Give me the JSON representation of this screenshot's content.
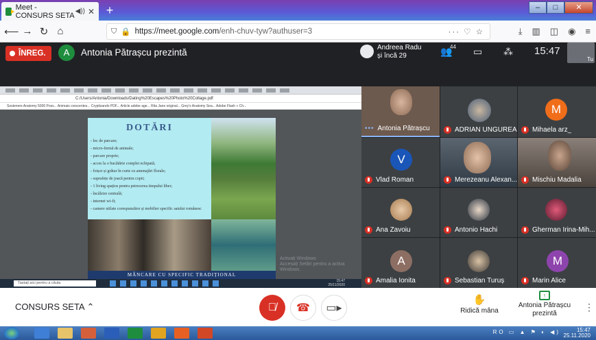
{
  "browser": {
    "tab_title": "Meet - CONSURS SETA",
    "new_tab": "+",
    "url_host": "https://meet.google.com",
    "url_path": "/enh-chuv-tyw?authuser=3",
    "url_extra": "··· ♡ ☆",
    "controls": {
      "minimize": "–",
      "maximize": "□",
      "close": "✕"
    }
  },
  "meet": {
    "recording_label": "ÎNREG.",
    "presenter_initial": "A",
    "presenter_text": "Antonia Pătrașcu prezintă",
    "participants_line1": "Andreea Radu",
    "participants_line2": "și încă 29",
    "participant_count": "44",
    "time": "15:47",
    "self_label": "Tu"
  },
  "shared_screen": {
    "url": "C:/Users/Antonia/Downloads/Dating%20Escapes%20Photo%20Collage.pdf",
    "bookmarks": "Sostenere   Anatomy 5000 Poss...   Animais crescentes...   Cryptizando PDF...   Article adobe age...   Rita Jane original...   Grey's Anatomy Sea...   Adobe Flash + Ch...",
    "pdf_title": "DOTĂRI",
    "pdf_items": [
      "- loc de parcare;",
      "- micro-fermă de animale;",
      "- parcare proprie;",
      "- acces la o bucătărie complet echipată;",
      "- foișor și grătar în curte cu amenajări florale;",
      "- suprafețe de joacă pentru copii;",
      "- 1 living spațios pentru petrecerea timpului liber;",
      "- încălzire centrală;",
      "- internet wi-fi;",
      "- camere utilate corespunzător și mobilier specific satului românesc"
    ],
    "pdf_banner": "MÂNCARE CU SPECIFIC TRADIȚIONAL",
    "activate_line1": "Activați Windows",
    "activate_line2": "Accesați Setări pentru a activa Windows.",
    "search_placeholder": "Tastați aici pentru a căuta",
    "clock_time": "15:47",
    "clock_date": "25/11/2020"
  },
  "participants": [
    {
      "name": "Antonia Pătrașcu",
      "kind": "photo",
      "active": true
    },
    {
      "name": "ADRIAN UNGUREA...",
      "kind": "photo"
    },
    {
      "name": "Mihaela arz_",
      "kind": "initial",
      "initial": "M",
      "color": "#f06d1a"
    },
    {
      "name": "Vlad Roman",
      "kind": "initial",
      "initial": "V",
      "color": "#1a56b8"
    },
    {
      "name": "Merezeanu Alexan...",
      "kind": "video"
    },
    {
      "name": "Mischiu Madalia",
      "kind": "video"
    },
    {
      "name": "Ana Zavoiu",
      "kind": "photo"
    },
    {
      "name": "Antonio Hachi",
      "kind": "photo"
    },
    {
      "name": "Gherman Irina-Mih...",
      "kind": "photo"
    },
    {
      "name": "Amalia Ionita",
      "kind": "initial",
      "initial": "A",
      "color": "#8d6e63"
    },
    {
      "name": "Sebastian Turuș",
      "kind": "photo"
    },
    {
      "name": "Marin Alice",
      "kind": "initial",
      "initial": "M",
      "color": "#8e44ad"
    }
  ],
  "bottom": {
    "meeting_name": "CONSURS SETA",
    "raise_hand": "Ridică mâna",
    "presenting_line1": "Antonia Pătrașcu",
    "presenting_line2": "prezintă"
  },
  "taskbar": {
    "time": "15:47",
    "date": "25.11.2020",
    "tray": "RO"
  }
}
